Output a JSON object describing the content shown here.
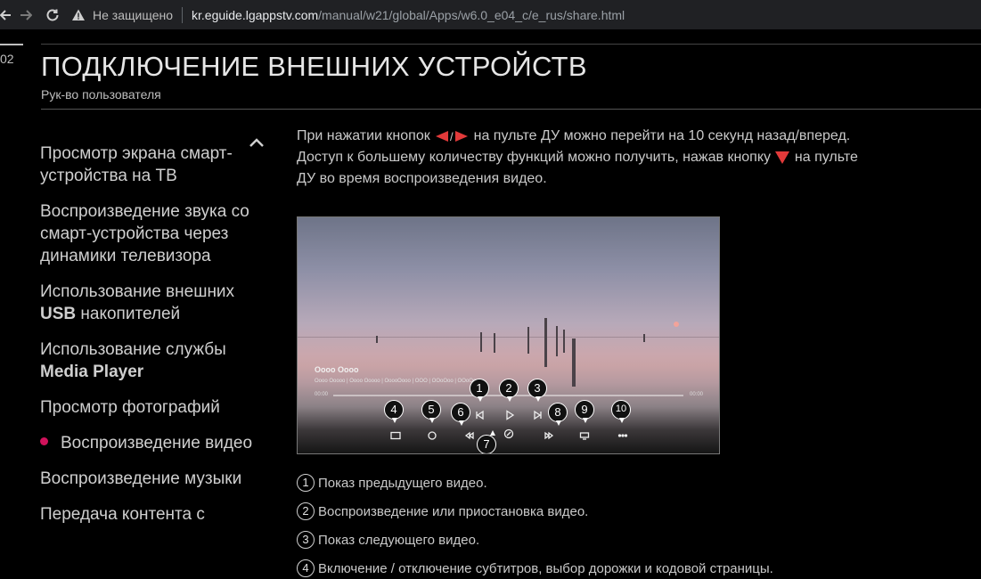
{
  "browser": {
    "security_label": "Не защищено",
    "url_host": "kr.eguide.lgappstv.com",
    "url_path": "/manual/w21/global/Apps/w6.0_e04_c/e_rus/share.html"
  },
  "page": {
    "page_number": "02",
    "title": "ПОДКЛЮЧЕНИЕ ВНЕШНИХ УСТРОЙСТВ",
    "subtitle": "Рук-во пользователя"
  },
  "sidebar": {
    "items": [
      {
        "label": "Просмотр экрана смарт-устройства на ТВ"
      },
      {
        "label": "Воспроизведение звука со смарт-устройства через динамики телевизора"
      },
      {
        "label_a": "Использование внешних ",
        "label_b": "USB",
        "label_c": " накопителей"
      },
      {
        "label_a": "Использование службы ",
        "label_b": "Media Player"
      },
      {
        "label": "Просмотр фотографий"
      },
      {
        "label": "Воспроизведение видео",
        "active": true
      },
      {
        "label": "Воспроизведение музыки"
      },
      {
        "label": "Передача контента с"
      }
    ]
  },
  "content": {
    "para1_a": "При нажатии кнопок ",
    "para1_b": " на пульте ДУ можно перейти на 10 секунд назад/вперед.",
    "para2_a": "Доступ к большему количеству функций можно получить, нажав кнопку ",
    "para2_b": " на пульте",
    "para3": "ДУ во время воспроизведения видео."
  },
  "video": {
    "title": "Oooo Oooo",
    "meta": "Oooo Ooooo | Oooo Ooooo | OoooOooo | OOO | OOoOoo | OOoOo",
    "time_start": "00:00",
    "time_end": "00:00",
    "callouts": [
      "1",
      "2",
      "3",
      "4",
      "5",
      "6",
      "7",
      "8",
      "9",
      "10"
    ]
  },
  "list": [
    {
      "num": "1",
      "text": "Показ предыдущего видео."
    },
    {
      "num": "2",
      "text": "Воспроизведение или приостановка видео."
    },
    {
      "num": "3",
      "text": "Показ следующего видео."
    },
    {
      "num": "4",
      "text": "Включение / отключение субтитров, выбор дорожки и кодовой страницы."
    }
  ],
  "colors": {
    "accent": "#d1125b",
    "remote_button": "#e23a3a",
    "background": "#000000"
  }
}
